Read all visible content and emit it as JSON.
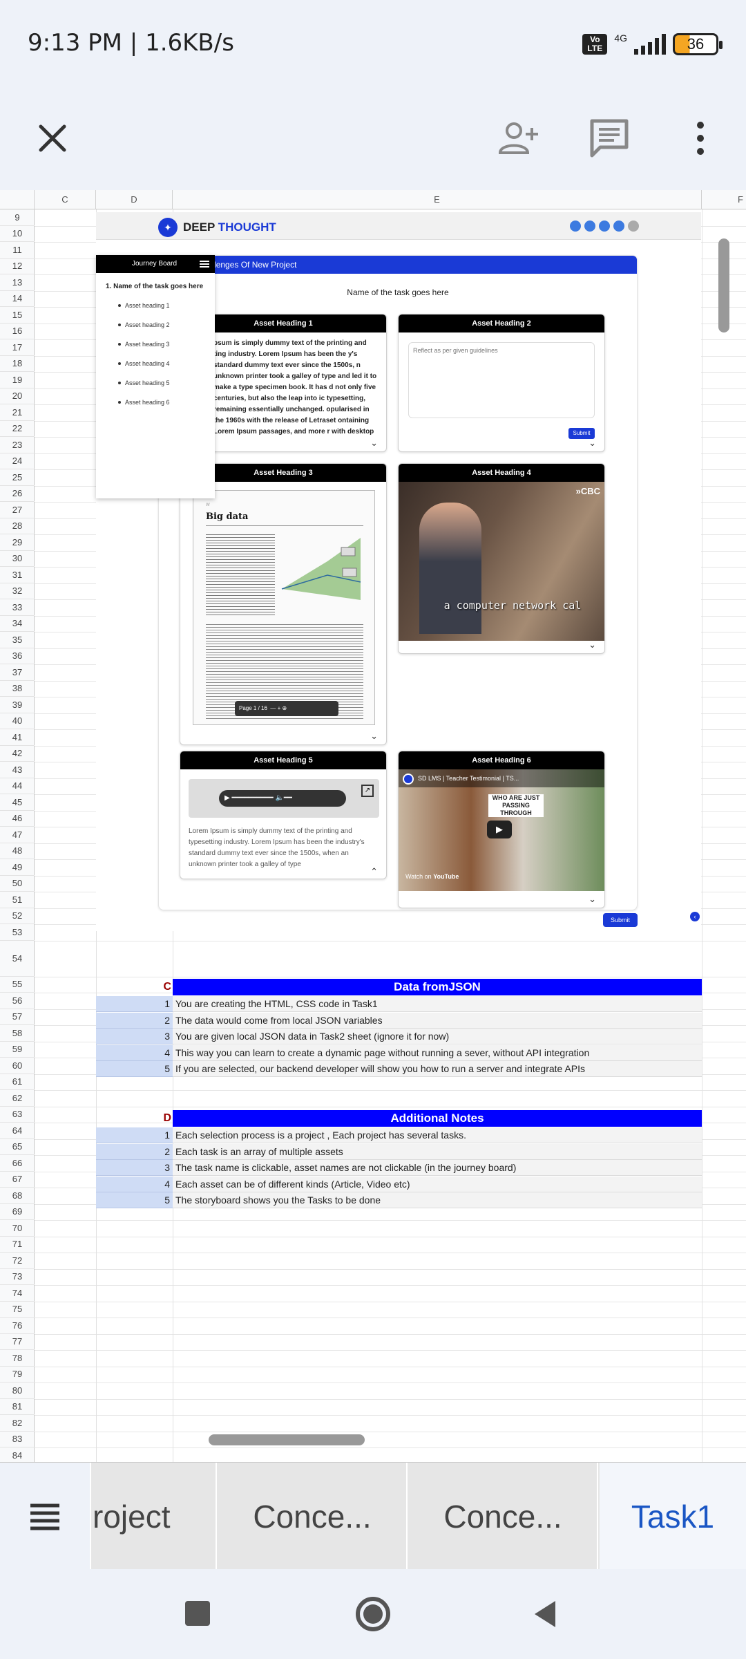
{
  "status": {
    "time": "9:13 PM | 1.6KB/s",
    "volte": "Vo LTE",
    "network": "4G",
    "battery": "36"
  },
  "sheet": {
    "columns": [
      "C",
      "D",
      "E",
      "F"
    ],
    "rows": [
      "9",
      "10",
      "11",
      "12",
      "13",
      "14",
      "15",
      "16",
      "17",
      "18",
      "19",
      "20",
      "21",
      "22",
      "23",
      "24",
      "25",
      "26",
      "27",
      "28",
      "29",
      "30",
      "31",
      "32",
      "33",
      "34",
      "35",
      "36",
      "37",
      "38",
      "39",
      "40",
      "41",
      "42",
      "43",
      "44",
      "45",
      "46",
      "47",
      "48",
      "49",
      "50",
      "51",
      "52",
      "53",
      "54",
      "55",
      "56",
      "57",
      "58",
      "59",
      "60",
      "61",
      "62",
      "63",
      "64",
      "65",
      "66",
      "67",
      "68",
      "69",
      "70",
      "71",
      "72",
      "73",
      "74",
      "75",
      "76",
      "77",
      "78",
      "79",
      "80",
      "81",
      "82",
      "83",
      "84"
    ]
  },
  "embed": {
    "brand_a": "DEEP ",
    "brand_b": "THOUGHT",
    "project_title": "ing Challenges Of New Project",
    "task_title": "Name of the task goes here",
    "journey": {
      "title": "Journey Board",
      "task": "1. Name of the task goes here",
      "items": [
        "Asset heading 1",
        "Asset heading 2",
        "Asset heading 3",
        "Asset heading 4",
        "Asset heading 5",
        "Asset heading 6"
      ]
    },
    "cards": {
      "c1": {
        "head": "Asset Heading 1",
        "text": "psum is simply dummy text of the printing and ting industry. Lorem Ipsum has been the y's standard dummy text ever since the 1500s, n unknown printer took a galley of type and led it to make a type specimen book. It has d not only five centuries, but also the leap into ic typesetting, remaining essentially unchanged. opularised in the 1960s with the release of Letraset ontaining Lorem Ipsum passages, and more r with desktop"
      },
      "c2": {
        "head": "Asset Heading 2",
        "placeholder": "Reflect as per given guidelines",
        "submit": "Submit"
      },
      "c3": {
        "head": "Asset Heading 3",
        "doc_title": "Big data",
        "page_label": "Page 1 / 16"
      },
      "c4": {
        "head": "Asset Heading 4",
        "watermark": "»CBC",
        "caption": "a computer network cal"
      },
      "c5": {
        "head": "Asset Heading 5",
        "text": "Lorem Ipsum is simply dummy text of the printing and typesetting industry. Lorem Ipsum has been the industry's standard dummy text ever since the 1500s, when an unknown printer took a galley of type"
      },
      "c6": {
        "head": "Asset Heading 6",
        "video_title": "SD LMS | Teacher Testimonial | TS...",
        "watch": "Watch on",
        "yt": "YouTube",
        "sign": "WHO ARE JUST PASSING THROUGH"
      }
    },
    "submit_bottom": "Submit"
  },
  "section_c": {
    "letter": "C",
    "title": "Data fromJSON",
    "rows": [
      {
        "n": "1",
        "t": "You are creating the HTML, CSS code in Task1"
      },
      {
        "n": "2",
        "t": "The data would come from local JSON variables"
      },
      {
        "n": "3",
        "t": "You are given local JSON data in Task2 sheet (ignore it for now)"
      },
      {
        "n": "4",
        "t": "This way you can learn to create a dynamic page without running a sever, without API integration"
      },
      {
        "n": "5",
        "t": "If you are selected, our backend developer will show you how to run a server and integrate APIs"
      }
    ]
  },
  "section_d": {
    "letter": "D",
    "title": "Additional Notes",
    "rows": [
      {
        "n": "1",
        "t": "Each selection process is a project , Each project has several tasks."
      },
      {
        "n": "2",
        "t": "Each task is an array of multiple assets"
      },
      {
        "n": "3",
        "t": "The task name is clickable, asset names are not clickable (in the journey board)"
      },
      {
        "n": "4",
        "t": "Each asset can be of different kinds (Article, Video etc)"
      },
      {
        "n": "5",
        "t": "The storyboard shows you the Tasks to be done"
      }
    ]
  },
  "tabs": [
    "roject",
    "Conce...",
    "Conce...",
    "Task1"
  ],
  "colors": {
    "accent": "#0000ff",
    "active_tab": "#1a56c4",
    "letter": "#990000"
  }
}
